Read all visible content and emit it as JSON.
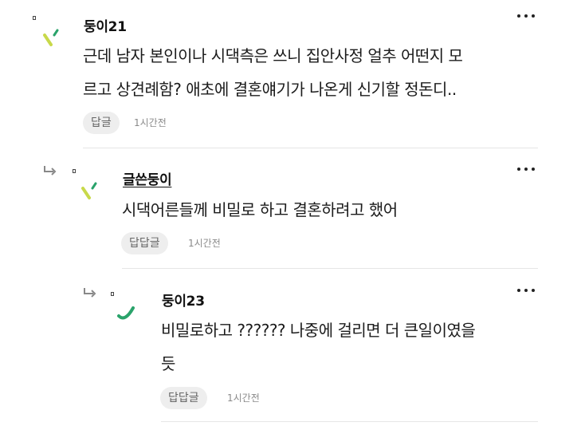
{
  "comments": [
    {
      "nickname": "둥이21",
      "text_lines": [
        "근데 남자 본인이나 시댁측은 쓰니 집안사정 얼추 어떤지 모",
        "르고 상견례함? 애초에 결혼얘기가 나온게 신기할 정돈디.."
      ],
      "reply_label": "답글",
      "time": "1시간전",
      "avatar_color": "#c8d94a"
    },
    {
      "nickname": "글쓴둥이",
      "text_lines": [
        "시댁어른들께 비밀로 하고 결혼하려고 했어"
      ],
      "reply_label": "답답글",
      "time": "1시간전",
      "avatar_color": "#c8d94a"
    },
    {
      "nickname": "둥이23",
      "text_lines": [
        "비밀로하고 ?????? 나중에 걸리면 더 큰일이였을",
        "듯"
      ],
      "reply_label": "답답글",
      "time": "1시간전",
      "avatar_color": "#2aa36b"
    }
  ],
  "icons": {
    "more": "more-options-icon",
    "reply_arrow": "reply-arrow-icon"
  }
}
